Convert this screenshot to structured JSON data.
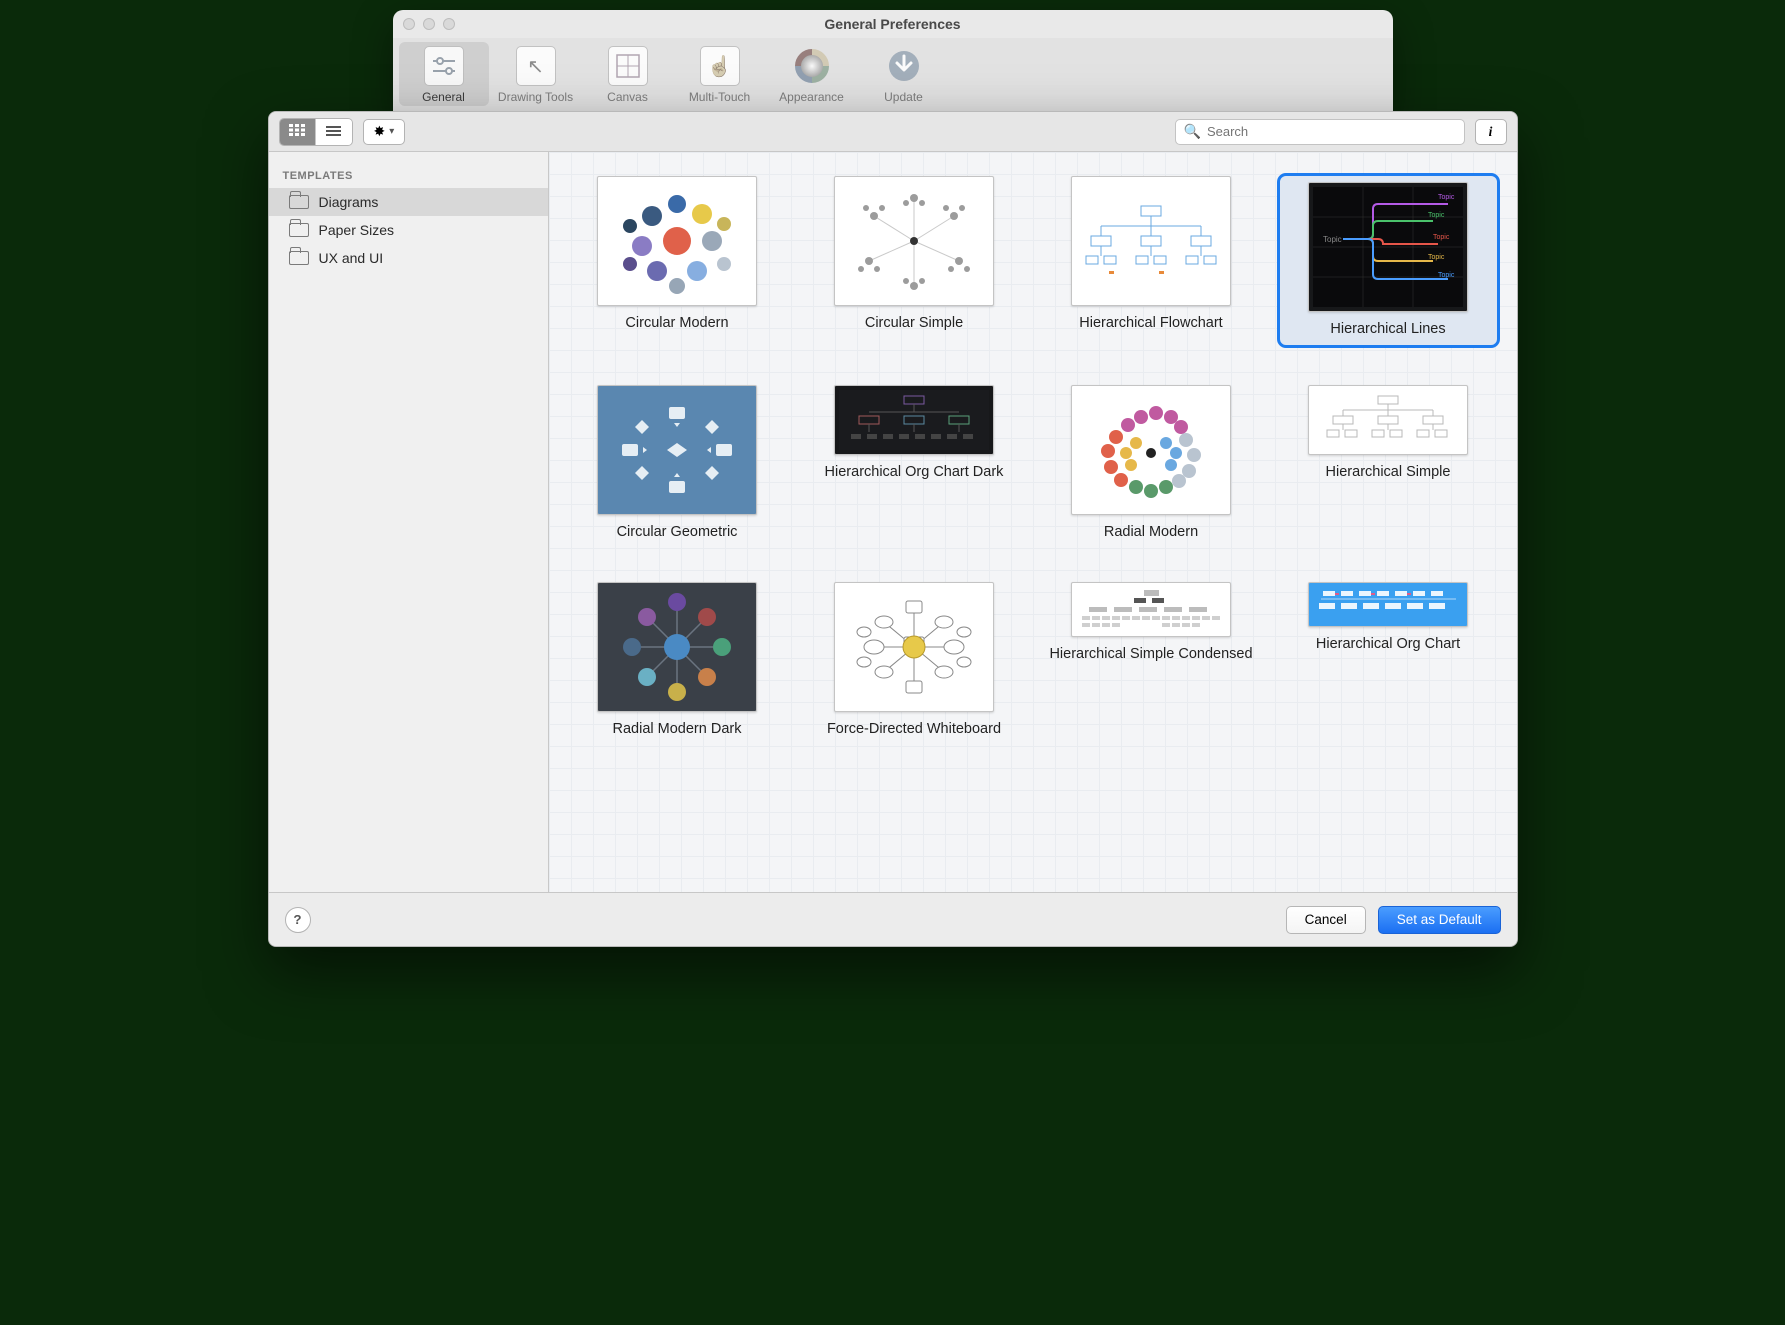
{
  "prefs": {
    "title": "General Preferences",
    "tabs": [
      {
        "label": "General"
      },
      {
        "label": "Drawing Tools"
      },
      {
        "label": "Canvas"
      },
      {
        "label": "Multi-Touch"
      },
      {
        "label": "Appearance"
      },
      {
        "label": "Update"
      }
    ]
  },
  "sheet": {
    "search_placeholder": "Search",
    "sidebar": {
      "header": "TEMPLATES",
      "items": [
        {
          "label": "Diagrams",
          "selected": true
        },
        {
          "label": "Paper Sizes",
          "selected": false
        },
        {
          "label": "UX and UI",
          "selected": false
        }
      ]
    },
    "templates": [
      {
        "label": "Circular Modern"
      },
      {
        "label": "Circular Simple"
      },
      {
        "label": "Hierarchical Flowchart"
      },
      {
        "label": "Hierarchical Lines",
        "selected": true
      },
      {
        "label": "Circular Geometric"
      },
      {
        "label": "Hierarchical Org Chart Dark"
      },
      {
        "label": "Radial Modern"
      },
      {
        "label": "Hierarchical Simple"
      },
      {
        "label": "Radial Modern Dark"
      },
      {
        "label": "Force-Directed Whiteboard"
      },
      {
        "label": "Hierarchical Simple Condensed"
      },
      {
        "label": "Hierarchical Org Chart"
      }
    ],
    "buttons": {
      "cancel": "Cancel",
      "set_default": "Set as Default"
    }
  }
}
